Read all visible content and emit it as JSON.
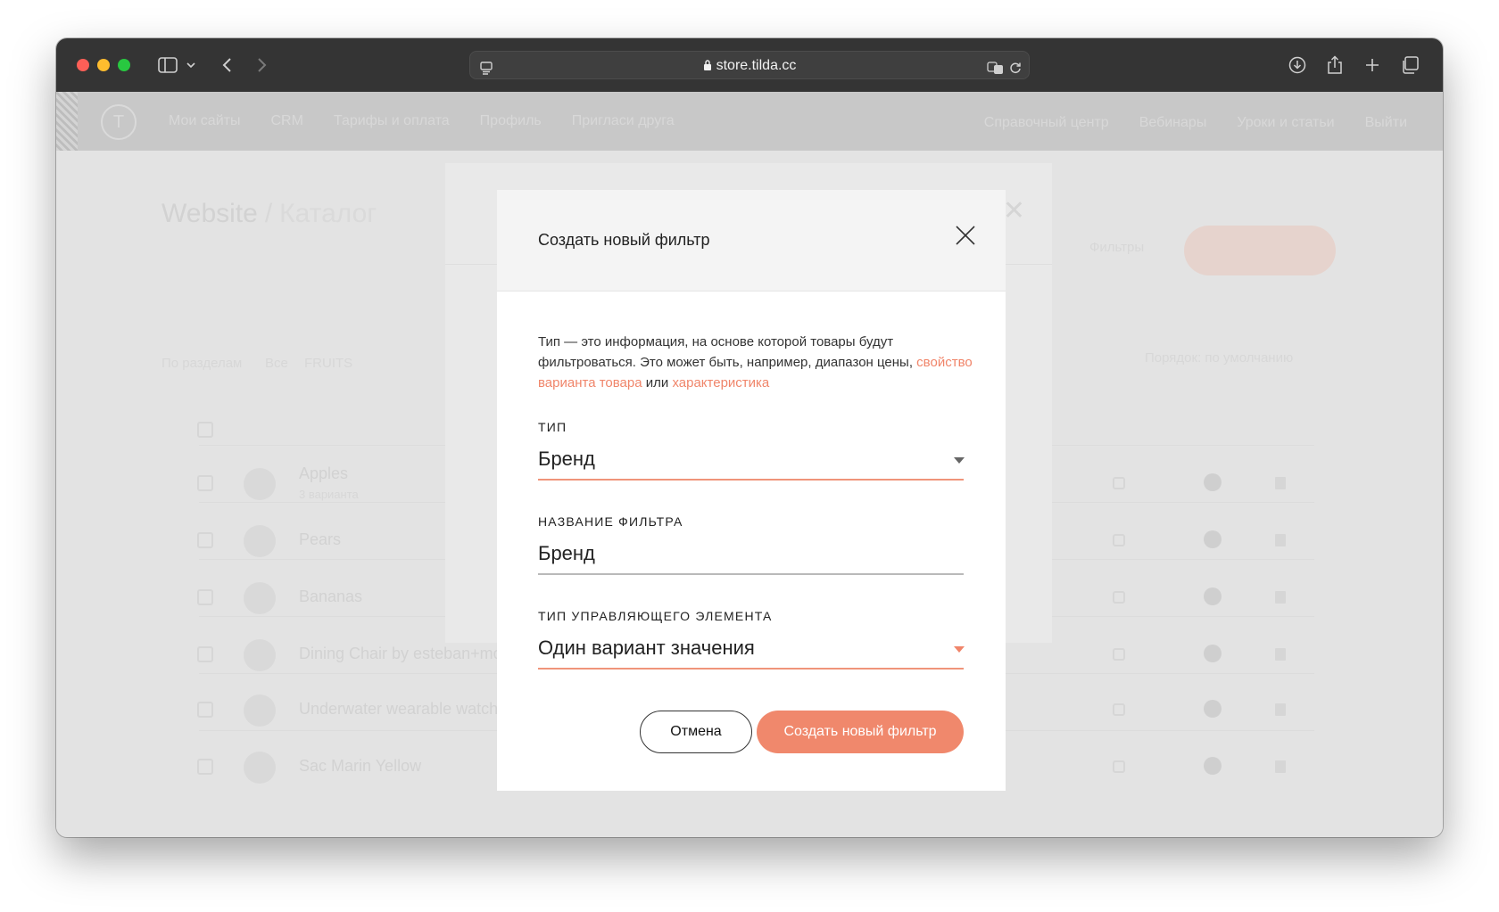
{
  "browser": {
    "url": "store.tilda.cc",
    "icons": [
      "sidebar-icon",
      "chevron-down-icon",
      "back-icon",
      "forward-icon",
      "page-menu-icon",
      "lock-icon",
      "translate-icon",
      "reload-icon",
      "download-icon",
      "share-icon",
      "new-tab-icon",
      "tab-overview-icon"
    ]
  },
  "nav": {
    "left": [
      "Мои сайты",
      "CRM",
      "Тарифы и оплата",
      "Профиль",
      "Пригласи друга"
    ],
    "right": [
      "Справочный центр",
      "Вебинары",
      "Уроки и статьи",
      "Выйти"
    ]
  },
  "page": {
    "title": "Website",
    "separator": "/",
    "subtitle": "Каталог",
    "filters_tab": "Фильтры",
    "section_label": "По разделам",
    "all": "Все",
    "fruits": "FRUITS",
    "sort": "Порядок: по умолчанию",
    "products": [
      "Apples",
      "Pears",
      "Bananas",
      "Dining Chair by esteban+mon",
      "Underwater wearable watch",
      "Sac Marin Yellow"
    ],
    "apples_sub": "3 варианта"
  },
  "modal": {
    "title": "Создать новый фильтр",
    "description": "Тип — это информация, на основе которой товары будут фильтроваться. Это может быть, например, диапазон цены,",
    "link1": "свойство варианта товара",
    "conj": "или",
    "link2": "характеристика",
    "type_label": "ТИП",
    "type_value": "Бренд",
    "name_label": "НАЗВАНИЕ ФИЛЬТРА",
    "name_value": "Бренд",
    "control_label": "ТИП УПРАВЛЯЮЩЕГО ЭЛЕМЕНТА",
    "control_value": "Один вариант значения",
    "cancel": "Отмена",
    "create": "Создать новый фильтр"
  },
  "colors": {
    "accent": "#f0886c",
    "toolbar": "#343434"
  }
}
